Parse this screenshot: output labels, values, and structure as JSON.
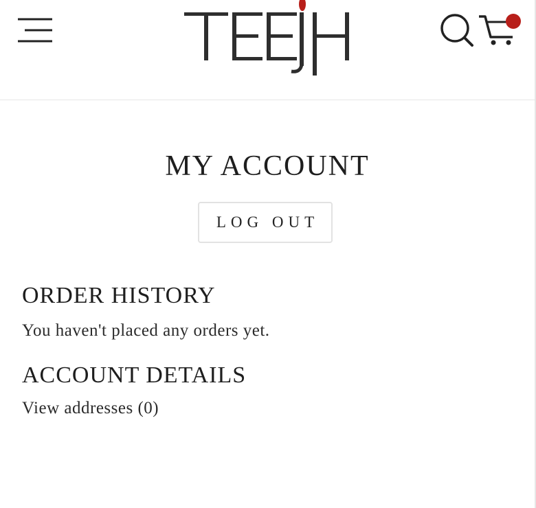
{
  "header": {
    "menu_icon": "hamburger-menu-icon",
    "logo_text": "TEEJH",
    "search_icon": "search-icon",
    "cart_icon": "cart-icon",
    "cart_badge_color": "#b81f1a",
    "logo_accent_color": "#b81f1a"
  },
  "account": {
    "title": "MY ACCOUNT",
    "logout_label": "LOG OUT"
  },
  "order_history": {
    "heading": "ORDER HISTORY",
    "empty_text": "You haven't placed any orders yet."
  },
  "account_details": {
    "heading": "ACCOUNT DETAILS",
    "addresses_link": "View addresses (0)"
  }
}
